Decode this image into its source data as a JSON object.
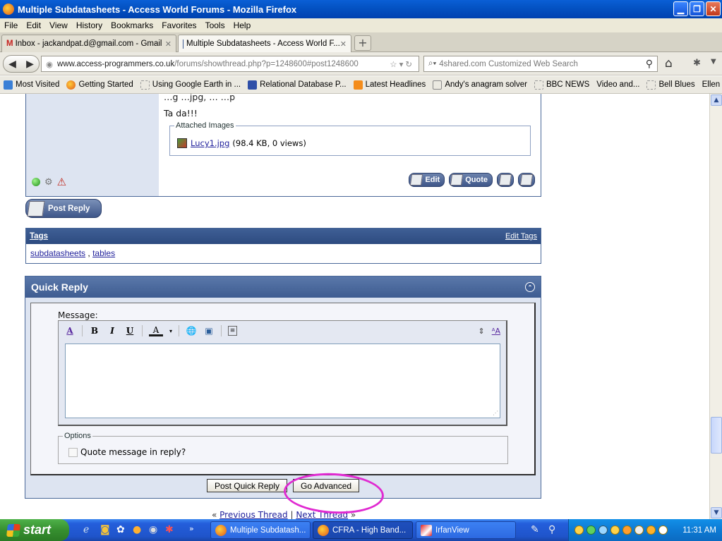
{
  "window": {
    "title": "Multiple Subdatasheets - Access World Forums - Mozilla Firefox"
  },
  "menu": [
    "File",
    "Edit",
    "View",
    "History",
    "Bookmarks",
    "Favorites",
    "Tools",
    "Help"
  ],
  "tabs": [
    {
      "label": "Inbox - jackandpat.d@gmail.com - Gmail",
      "active": false
    },
    {
      "label": "Multiple Subdatasheets - Access World F...",
      "active": true
    }
  ],
  "nav": {
    "url_domain": "www.access-programmers.co.uk",
    "url_path": "/forums/showthread.php?p=1248600#post1248600",
    "search_placeholder": "4shared.com Customized Web Search"
  },
  "bookmarks": [
    "Most Visited",
    "Getting Started",
    "Using Google Earth in ...",
    "Relational Database P...",
    "Latest Headlines",
    "Andy's anagram solver",
    "BBC NEWS",
    "Video and...",
    "Bell Blues",
    "Ellen Rose..."
  ],
  "post": {
    "text": "Ta da!!!",
    "partial_line": "…g                 …jpg, …         …p",
    "attached_images_legend": "Attached Images",
    "attachment_name": "Lucy1.jpg",
    "attachment_meta": "(98.4 KB, 0 views)",
    "edit_label": "Edit",
    "quote_label": "Quote"
  },
  "post_reply_label": "Post Reply",
  "tags": {
    "title": "Tags",
    "edit_label": "Edit Tags",
    "tag1": "subdatasheets",
    "separator": " , ",
    "tag2": "tables"
  },
  "quick_reply": {
    "title": "Quick Reply",
    "message_label": "Message:",
    "options_legend": "Options",
    "quote_option": "Quote message in reply?",
    "post_button": "Post Quick Reply",
    "advanced_button": "Go Advanced"
  },
  "thread_nav": {
    "prev": "Previous Thread",
    "separator": " | ",
    "next": "Next Thread"
  },
  "taskbar": {
    "start_label": "start",
    "buttons": [
      "Multiple Subdatash...",
      "CFRA - High Band...",
      "IrfanView"
    ],
    "clock": "11:31 AM"
  }
}
